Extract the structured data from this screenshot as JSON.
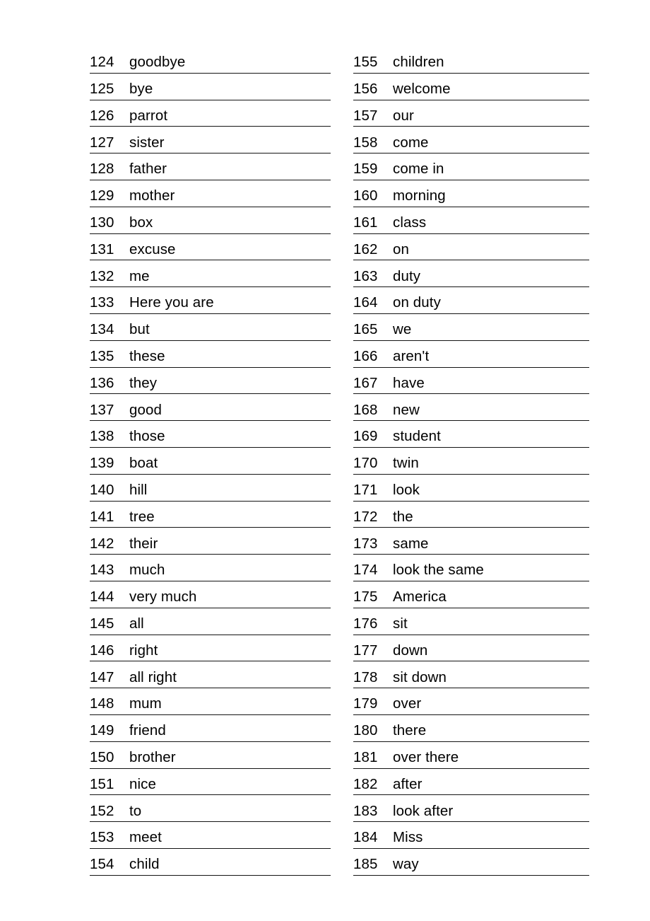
{
  "document": {
    "type": "vocabulary-word-list",
    "layout": "two-column",
    "ink_color": "#141414",
    "paper_color": "#ffffff"
  },
  "columns": [
    {
      "name": "left-column",
      "entries": [
        {
          "number": "124",
          "word": "goodbye"
        },
        {
          "number": "125",
          "word": "bye"
        },
        {
          "number": "126",
          "word": "parrot"
        },
        {
          "number": "127",
          "word": "sister"
        },
        {
          "number": "128",
          "word": "father"
        },
        {
          "number": "129",
          "word": "mother"
        },
        {
          "number": "130",
          "word": "box"
        },
        {
          "number": "131",
          "word": "excuse"
        },
        {
          "number": "132",
          "word": "me"
        },
        {
          "number": "133",
          "word": "Here you are"
        },
        {
          "number": "134",
          "word": "but"
        },
        {
          "number": "135",
          "word": "these"
        },
        {
          "number": "136",
          "word": "they"
        },
        {
          "number": "137",
          "word": "good"
        },
        {
          "number": "138",
          "word": "those"
        },
        {
          "number": "139",
          "word": "boat"
        },
        {
          "number": "140",
          "word": "hill"
        },
        {
          "number": "141",
          "word": "tree"
        },
        {
          "number": "142",
          "word": "their"
        },
        {
          "number": "143",
          "word": "much"
        },
        {
          "number": "144",
          "word": "very much"
        },
        {
          "number": "145",
          "word": "all"
        },
        {
          "number": "146",
          "word": "right"
        },
        {
          "number": "147",
          "word": "all right"
        },
        {
          "number": "148",
          "word": "mum"
        },
        {
          "number": "149",
          "word": "friend"
        },
        {
          "number": "150",
          "word": "brother"
        },
        {
          "number": "151",
          "word": "nice"
        },
        {
          "number": "152",
          "word": "to"
        },
        {
          "number": "153",
          "word": "meet"
        },
        {
          "number": "154",
          "word": "child"
        }
      ]
    },
    {
      "name": "right-column",
      "entries": [
        {
          "number": "155",
          "word": "children"
        },
        {
          "number": "156",
          "word": "welcome"
        },
        {
          "number": "157",
          "word": "our"
        },
        {
          "number": "158",
          "word": "come"
        },
        {
          "number": "159",
          "word": "come in"
        },
        {
          "number": "160",
          "word": "morning"
        },
        {
          "number": "161",
          "word": "class"
        },
        {
          "number": "162",
          "word": "on"
        },
        {
          "number": "163",
          "word": "duty"
        },
        {
          "number": "164",
          "word": "on duty"
        },
        {
          "number": "165",
          "word": "we"
        },
        {
          "number": "166",
          "word": "aren't"
        },
        {
          "number": "167",
          "word": "have"
        },
        {
          "number": "168",
          "word": "new"
        },
        {
          "number": "169",
          "word": "student"
        },
        {
          "number": "170",
          "word": "twin"
        },
        {
          "number": "171",
          "word": "look"
        },
        {
          "number": "172",
          "word": "the"
        },
        {
          "number": "173",
          "word": "same"
        },
        {
          "number": "174",
          "word": "look the same"
        },
        {
          "number": "175",
          "word": "America"
        },
        {
          "number": "176",
          "word": "sit"
        },
        {
          "number": "177",
          "word": "down"
        },
        {
          "number": "178",
          "word": "sit down"
        },
        {
          "number": "179",
          "word": "over"
        },
        {
          "number": "180",
          "word": "there"
        },
        {
          "number": "181",
          "word": "over there"
        },
        {
          "number": "182",
          "word": "after"
        },
        {
          "number": "183",
          "word": "look after"
        },
        {
          "number": "184",
          "word": "Miss"
        },
        {
          "number": "185",
          "word": "way"
        }
      ]
    }
  ]
}
